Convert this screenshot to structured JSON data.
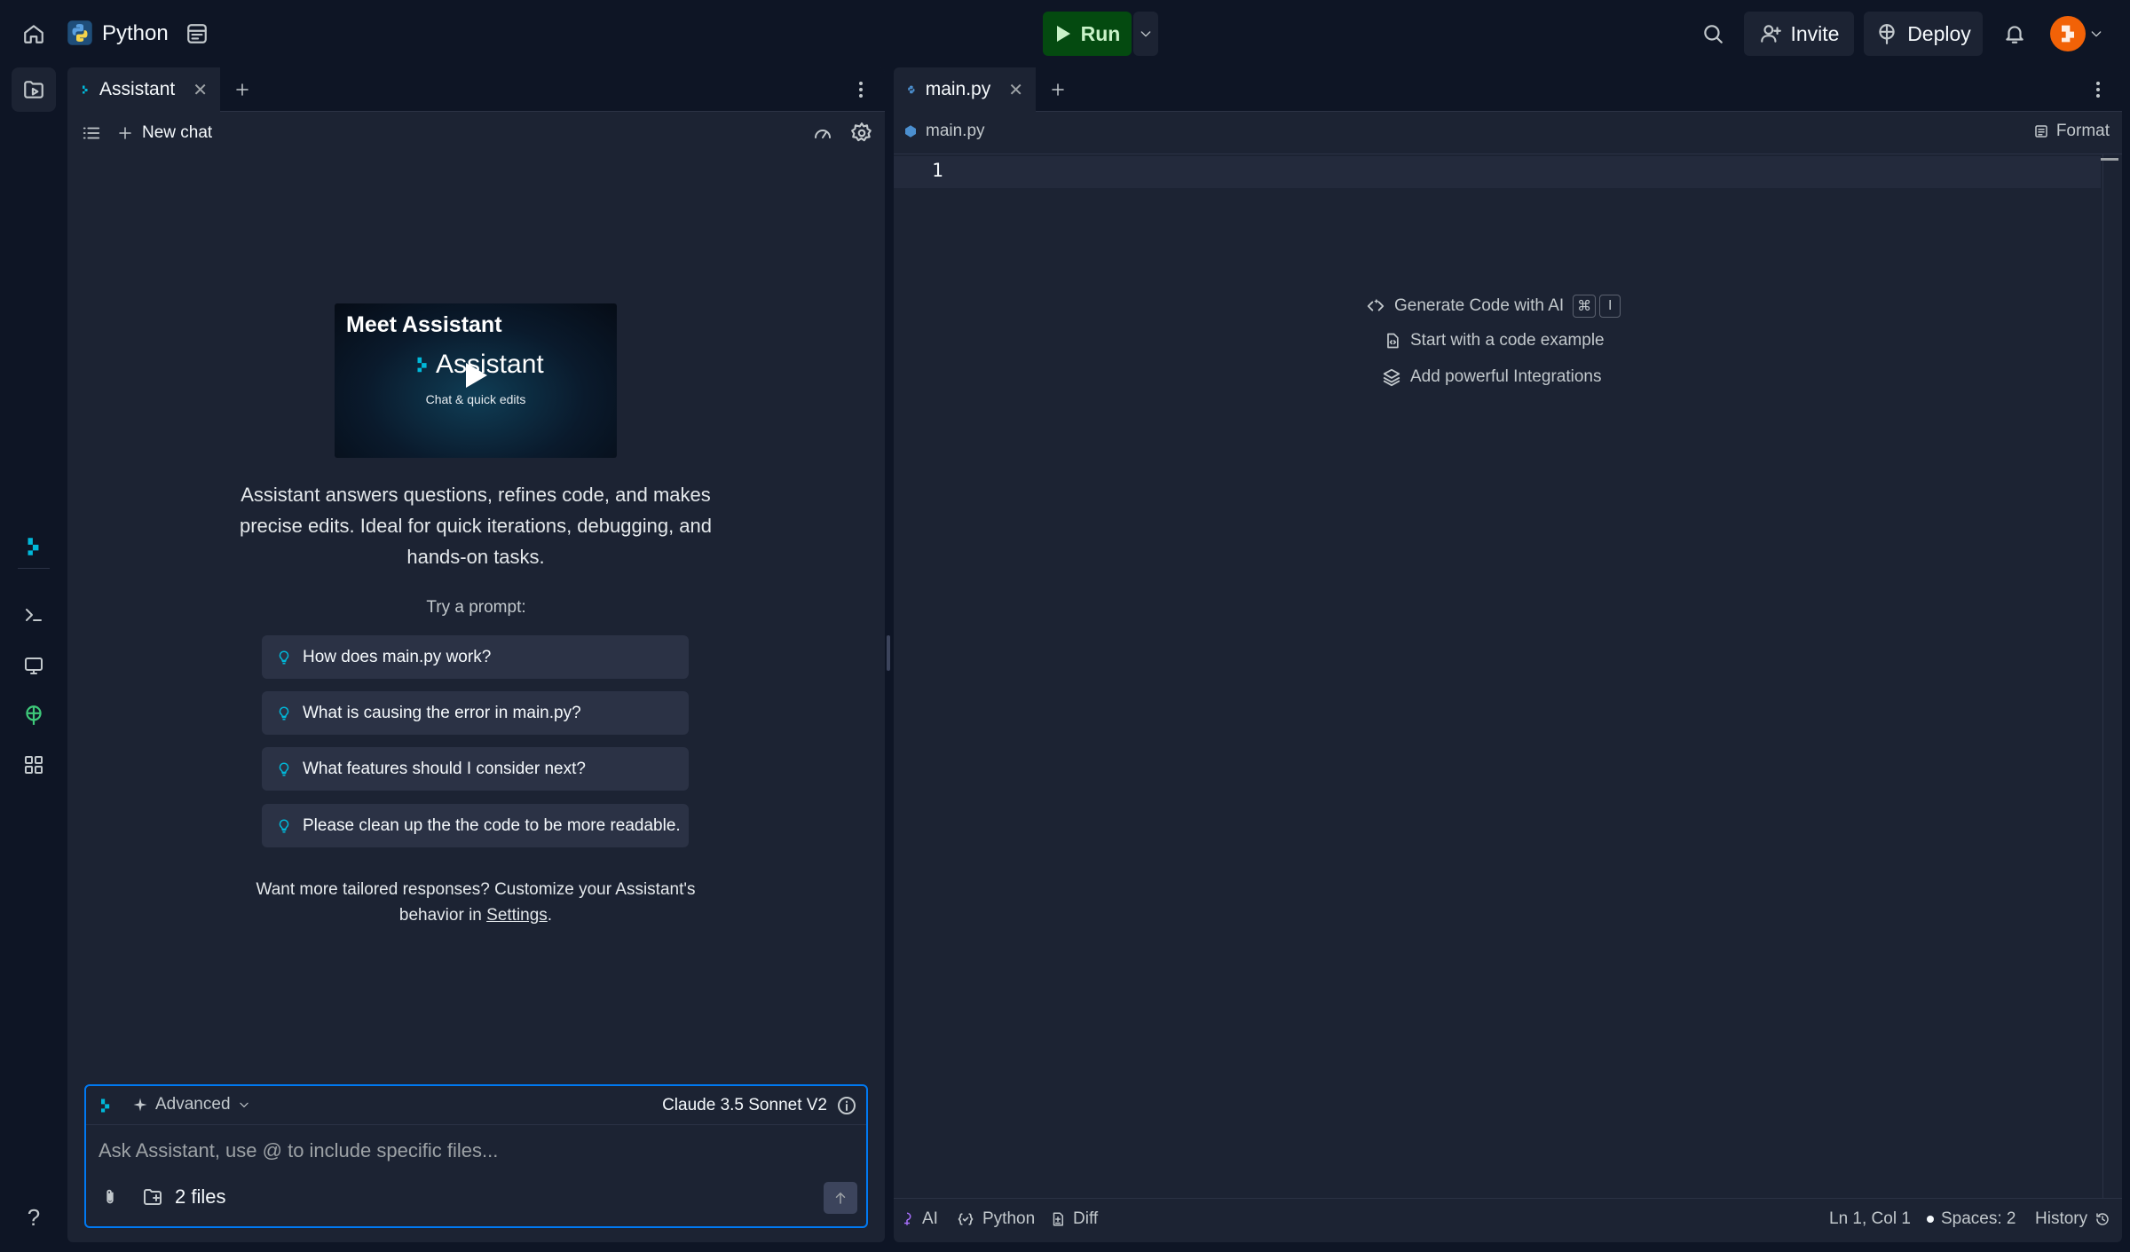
{
  "topbar": {
    "repl_name": "Python",
    "run_label": "Run",
    "invite_label": "Invite",
    "deploy_label": "Deploy"
  },
  "assistant_pane": {
    "tab_label": "Assistant",
    "new_chat_label": "New chat",
    "promo": {
      "title": "Meet Assistant",
      "brand": "Assistant",
      "subtitle": "Chat & quick edits"
    },
    "description": "Assistant answers questions, refines code, and makes precise edits. Ideal for quick iterations, debugging, and hands-on tasks.",
    "try_label": "Try a prompt:",
    "prompts": [
      "How does main.py work?",
      "What is causing the error in main.py?",
      "What features should I consider next?",
      "Please clean up the the code to be more readable."
    ],
    "custom_note_prefix": "Want more tailored responses? Customize your Assistant's behavior in ",
    "custom_note_link": "Settings",
    "custom_note_suffix": ".",
    "input": {
      "mode": "Advanced",
      "model": "Claude 3.5 Sonnet V2",
      "placeholder": "Ask Assistant, use @ to include specific files...",
      "value": "",
      "files_label": "2 files"
    }
  },
  "editor_pane": {
    "tab_label": "main.py",
    "breadcrumb": "main.py",
    "format_label": "Format",
    "line_number": "1",
    "hints": {
      "generate": "Generate Code with AI",
      "generate_keys": [
        "⌘",
        "I"
      ],
      "example": "Start with a code example",
      "integrations": "Add powerful Integrations"
    },
    "statusbar": {
      "ai": "AI",
      "language": "Python",
      "diff": "Diff",
      "position": "Ln 1, Col 1",
      "spaces": "Spaces: 2",
      "history": "History"
    }
  },
  "colors": {
    "background": "#0e1525",
    "panel": "#1c2333",
    "run_green": "#044a10",
    "focus_blue": "#0079f2",
    "avatar_orange": "#f26207"
  },
  "icons": [
    "home-icon",
    "python-logo-icon",
    "repl-info-icon",
    "play-icon",
    "chevron-down-icon",
    "search-icon",
    "add-user-icon",
    "deploy-icon",
    "bell-icon",
    "files-icon",
    "assistant-icon",
    "shell-icon",
    "webview-icon",
    "deployments-icon",
    "apps-grid-icon",
    "help-icon",
    "lightbulb-icon",
    "paperclip-icon",
    "folder-add-icon",
    "send-arrow-icon",
    "gear-icon",
    "gauge-icon",
    "sparkle-icon",
    "info-icon",
    "format-icon",
    "history-icon"
  ]
}
